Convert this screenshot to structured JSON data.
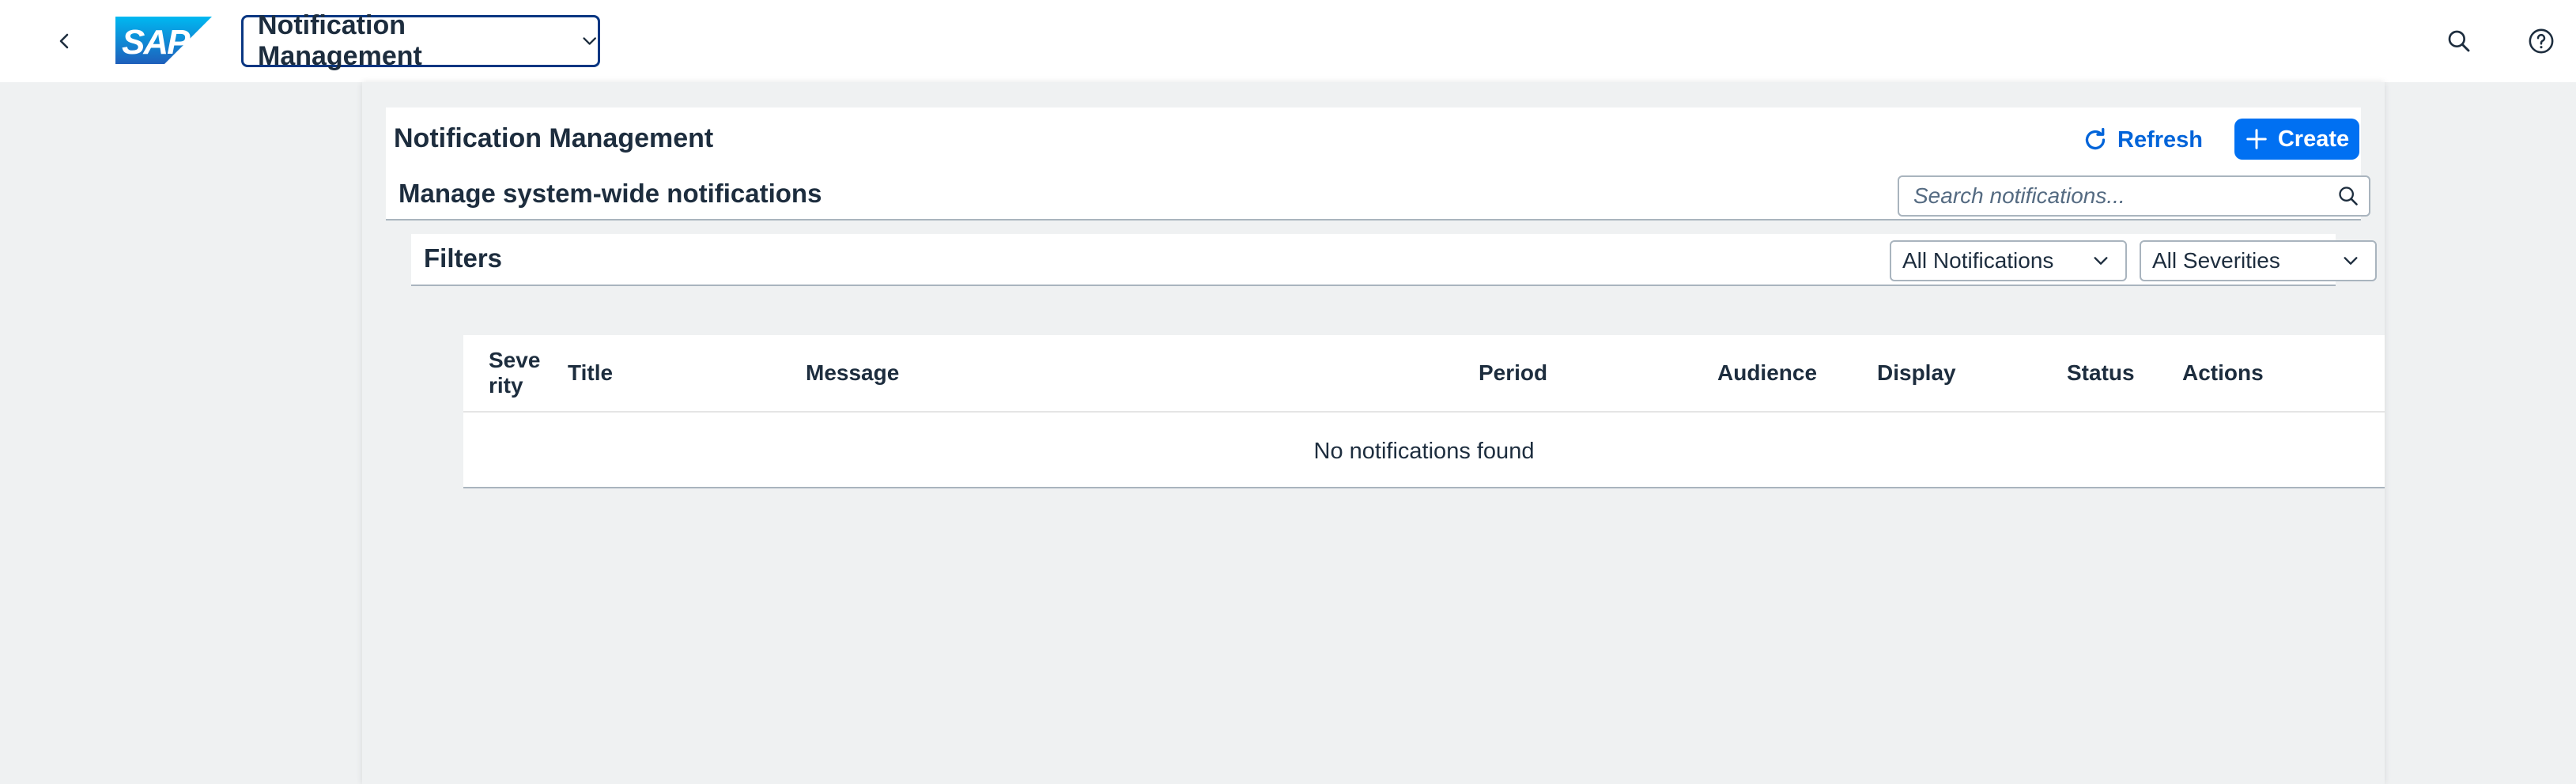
{
  "shell": {
    "app_title": "Notification Management",
    "logo_text": "SAP"
  },
  "header": {
    "title": "Notification Management",
    "subtitle": "Manage system-wide notifications",
    "refresh_label": "Refresh",
    "create_label": "Create",
    "search_placeholder": "Search notifications..."
  },
  "filters": {
    "title": "Filters",
    "type_select": "All Notifications",
    "severity_select": "All Severities"
  },
  "table": {
    "columns": {
      "severity_line1": "Seve",
      "severity_line2": "rity",
      "title": "Title",
      "message": "Message",
      "period": "Period",
      "audience": "Audience",
      "display": "Display",
      "status": "Status",
      "actions": "Actions"
    },
    "empty_text": "No notifications found"
  },
  "colors": {
    "brand_blue": "#0070f2",
    "link_blue": "#0064d9",
    "text": "#1d2d3e",
    "background": "#eff1f2"
  }
}
